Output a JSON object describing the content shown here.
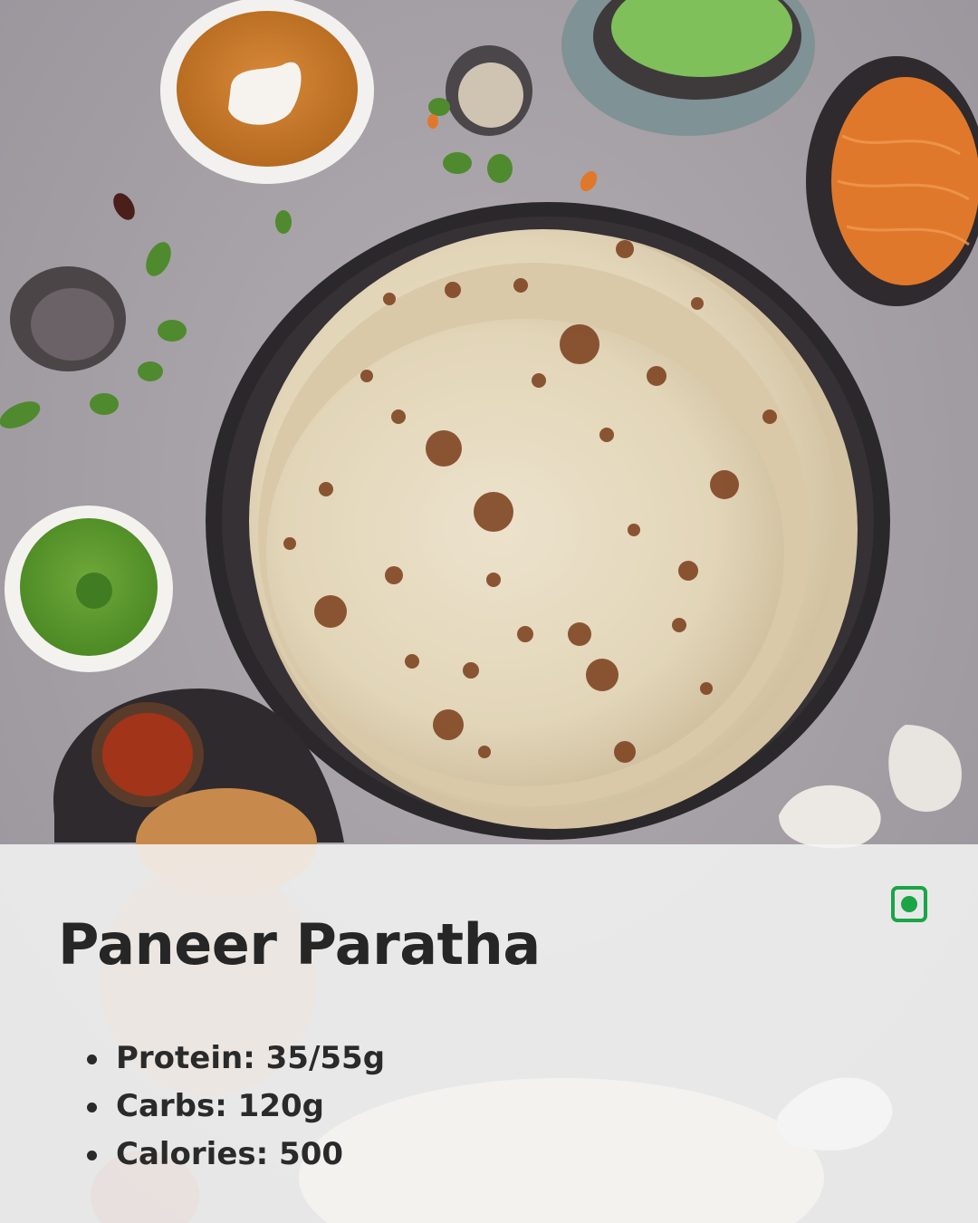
{
  "recipe": {
    "title": "Paneer Paratha",
    "veg_indicator_icon": "veg-indicator-icon",
    "veg_color": "#1aa546",
    "nutrients": [
      {
        "label": "Protein: 35/55g"
      },
      {
        "label": "Carbs: 120g"
      },
      {
        "label": "Calories: 500"
      }
    ]
  },
  "photo": {
    "subject": "food-photo",
    "background_color": "#a7a2a6"
  }
}
